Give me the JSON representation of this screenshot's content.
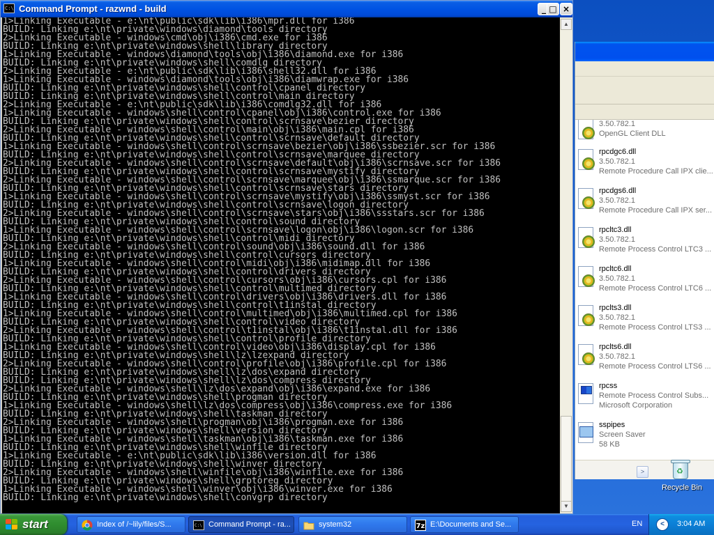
{
  "cmd": {
    "title": "Command Prompt - razwnd - build",
    "buttons": {
      "minimize": "_",
      "maximize": "□",
      "close": "×"
    },
    "lines": [
      "1>Linking Executable - e:\\nt\\public\\sdk\\lib\\i386\\mpr.dll for i386",
      "BUILD: Linking e:\\nt\\private\\windows\\diamond\\tools directory",
      "2>Linking Executable - windows\\cmd\\obj\\i386\\cmd.exe for i386",
      "BUILD: Linking e:\\nt\\private\\windows\\shell\\library directory",
      "1>Linking Executable - windows\\diamond\\tools\\obj\\i386\\diamond.exe for i386",
      "BUILD: Linking e:\\nt\\private\\windows\\shell\\comdlg directory",
      "2>Linking Executable - e:\\nt\\public\\sdk\\lib\\i386\\shell32.dll for i386",
      "1>Linking Executable - windows\\diamond\\tools\\obj\\i386\\diamwrap.exe for i386",
      "BUILD: Linking e:\\nt\\private\\windows\\shell\\control\\cpanel directory",
      "BUILD: Linking e:\\nt\\private\\windows\\shell\\control\\main directory",
      "2>Linking Executable - e:\\nt\\public\\sdk\\lib\\i386\\comdlg32.dll for i386",
      "1>Linking Executable - windows\\shell\\control\\cpanel\\obj\\i386\\control.exe for i386",
      "BUILD: Linking e:\\nt\\private\\windows\\shell\\control\\scrnsave\\bezier directory",
      "2>Linking Executable - windows\\shell\\control\\main\\obj\\i386\\main.cpl for i386",
      "BUILD: Linking e:\\nt\\private\\windows\\shell\\control\\scrnsave\\default directory",
      "1>Linking Executable - windows\\shell\\control\\scrnsave\\bezier\\obj\\i386\\ssbezier.scr for i386",
      "BUILD: Linking e:\\nt\\private\\windows\\shell\\control\\scrnsave\\marquee directory",
      "2>Linking Executable - windows\\shell\\control\\scrnsave\\default\\obj\\i386\\scrnsave.scr for i386",
      "BUILD: Linking e:\\nt\\private\\windows\\shell\\control\\scrnsave\\mystify directory",
      "2>Linking Executable - windows\\shell\\control\\scrnsave\\marquee\\obj\\i386\\ssmarque.scr for i386",
      "BUILD: Linking e:\\nt\\private\\windows\\shell\\control\\scrnsave\\stars directory",
      "1>Linking Executable - windows\\shell\\control\\scrnsave\\mystify\\obj\\i386\\ssmyst.scr for i386",
      "BUILD: Linking e:\\nt\\private\\windows\\shell\\control\\scrnsave\\logon directory",
      "2>Linking Executable - windows\\shell\\control\\scrnsave\\stars\\obj\\i386\\ssstars.scr for i386",
      "BUILD: Linking e:\\nt\\private\\windows\\shell\\control\\sound directory",
      "1>Linking Executable - windows\\shell\\control\\scrnsave\\logon\\obj\\i386\\logon.scr for i386",
      "BUILD: Linking e:\\nt\\private\\windows\\shell\\control\\midi directory",
      "2>Linking Executable - windows\\shell\\control\\sound\\obj\\i386\\sound.dll for i386",
      "BUILD: Linking e:\\nt\\private\\windows\\shell\\control\\cursors directory",
      "1>Linking Executable - windows\\shell\\control\\midi\\obj\\i386\\midimap.dll for i386",
      "BUILD: Linking e:\\nt\\private\\windows\\shell\\control\\drivers directory",
      "2>Linking Executable - windows\\shell\\control\\cursors\\obj\\i386\\cursors.cpl for i386",
      "BUILD: Linking e:\\nt\\private\\windows\\shell\\control\\multimed directory",
      "1>Linking Executable - windows\\shell\\control\\drivers\\obj\\i386\\drivers.dll for i386",
      "BUILD: Linking e:\\nt\\private\\windows\\shell\\control\\t1instal directory",
      "1>Linking Executable - windows\\shell\\control\\multimed\\obj\\i386\\multimed.cpl for i386",
      "BUILD: Linking e:\\nt\\private\\windows\\shell\\control\\video directory",
      "2>Linking Executable - windows\\shell\\control\\t1instal\\obj\\i386\\t1instal.dll for i386",
      "BUILD: Linking e:\\nt\\private\\windows\\shell\\control\\profile directory",
      "1>Linking Executable - windows\\shell\\control\\video\\obj\\i386\\display.cpl for i386",
      "BUILD: Linking e:\\nt\\private\\windows\\shell\\lz\\lzexpand directory",
      "2>Linking Executable - windows\\shell\\control\\profile\\obj\\i386\\profile.cpl for i386",
      "BUILD: Linking e:\\nt\\private\\windows\\shell\\lz\\dos\\expand directory",
      "BUILD: Linking e:\\nt\\private\\windows\\shell\\lz\\dos\\compress directory",
      "2>Linking Executable - windows\\shell\\lz\\dos\\expand\\obj\\i386\\expand.exe for i386",
      "BUILD: Linking e:\\nt\\private\\windows\\shell\\progman directory",
      "1>Linking Executable - windows\\shell\\lz\\dos\\compress\\obj\\i386\\compress.exe for i386",
      "BUILD: Linking e:\\nt\\private\\windows\\shell\\taskman directory",
      "2>Linking Executable - windows\\shell\\progman\\obj\\i386\\progman.exe for i386",
      "BUILD: Linking e:\\nt\\private\\windows\\shell\\version directory",
      "1>Linking Executable - windows\\shell\\taskman\\obj\\i386\\taskman.exe for i386",
      "BUILD: Linking e:\\nt\\private\\windows\\shell\\winfile directory",
      "1>Linking Executable - e:\\nt\\public\\sdk\\lib\\i386\\version.dll for i386",
      "BUILD: Linking e:\\nt\\private\\windows\\shell\\winver directory",
      "2>Linking Executable - windows\\shell\\winfile\\obj\\i386\\winfile.exe for i386",
      "BUILD: Linking e:\\nt\\private\\windows\\shell\\grptoreg directory",
      "1>Linking Executable - windows\\shell\\winver\\obj\\i386\\winver.exe for i386",
      "BUILD: Linking e:\\nt\\private\\windows\\shell\\convgrp directory"
    ]
  },
  "explorer": {
    "files": [
      {
        "name": "",
        "line1": "3.50.782.1",
        "line2": "OpenGL Client DLL",
        "icon": "dll-gear-icon"
      },
      {
        "name": "rpcdgc6.dll",
        "line1": "3.50.782.1",
        "line2": "Remote Procedure Call IPX clie...",
        "icon": "dll-gear-icon"
      },
      {
        "name": "rpcdgs6.dll",
        "line1": "3.50.782.1",
        "line2": "Remote Procedure Call IPX ser...",
        "icon": "dll-gear-icon"
      },
      {
        "name": "rpcltc3.dll",
        "line1": "3.50.782.1",
        "line2": "Remote Process Control LTC3 ...",
        "icon": "dll-gear-icon"
      },
      {
        "name": "rpcltc6.dll",
        "line1": "3.50.782.1",
        "line2": "Remote Process Control LTC6 ...",
        "icon": "dll-gear-icon"
      },
      {
        "name": "rpclts3.dll",
        "line1": "3.50.782.1",
        "line2": "Remote Process Control LTS3 ...",
        "icon": "dll-gear-icon"
      },
      {
        "name": "rpclts6.dll",
        "line1": "3.50.782.1",
        "line2": "Remote Process Control LTS6 ...",
        "icon": "dll-gear-icon"
      },
      {
        "name": "rpcss",
        "line1": "Remote Process Control Subs...",
        "line2": "Microsoft Corporation",
        "icon": "exe-window-icon"
      },
      {
        "name": "sspipes",
        "line1": "Screen Saver",
        "line2": "58 KB",
        "icon": "screensaver-icon"
      }
    ],
    "scroll_arrow": ">"
  },
  "desktop": {
    "recycle_bin_label": "Recycle Bin"
  },
  "taskbar": {
    "start_label": "start",
    "tasks": [
      {
        "label": "Index of /~lily/files/S...",
        "icon": "chrome-icon"
      },
      {
        "label": "Command Prompt - ra...",
        "icon": "cmd-icon"
      },
      {
        "label": "system32",
        "icon": "folder-icon"
      },
      {
        "label": "E:\\Documents and Se...",
        "icon": "7zip-icon"
      }
    ],
    "language": "EN",
    "clock": "3:04 AM"
  },
  "colors": {
    "console_bg": "#000000",
    "console_text": "#c0c0c0",
    "titlebar": "#0053e3",
    "taskbar": "#245edb",
    "start_button": "#3b993b"
  }
}
